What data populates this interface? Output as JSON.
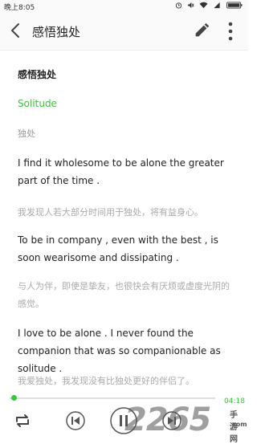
{
  "status_bar": {
    "time": "晚上8:05"
  },
  "header": {
    "title": "感悟独处"
  },
  "article": {
    "heading": "感悟独处",
    "word": "Solitude",
    "word_translation": "独处",
    "paragraphs": [
      {
        "en": "I find it wholesome to be alone the greater part of the time .",
        "cn": "我发现人若大部分时间用于独处，将有益身心。"
      },
      {
        "en": "To be in company , even with the best , is soon wearisome and dissipating .",
        "cn": "与人为伴，即使是挚友，也很快会有厌烦或虚度光阴的感觉。"
      },
      {
        "en": "I love to be alone . I never found the companion that was so companionable as solitude .",
        "cn": "我爱独处，我发现没有比独处更好的伴侣了。"
      }
    ]
  },
  "player": {
    "elapsed": "04:18",
    "progress": 0.02
  },
  "watermark": {
    "brand": "2265",
    "cn": "手游网",
    "url": ".com"
  },
  "colors": {
    "accent": "#3fbf3f"
  }
}
